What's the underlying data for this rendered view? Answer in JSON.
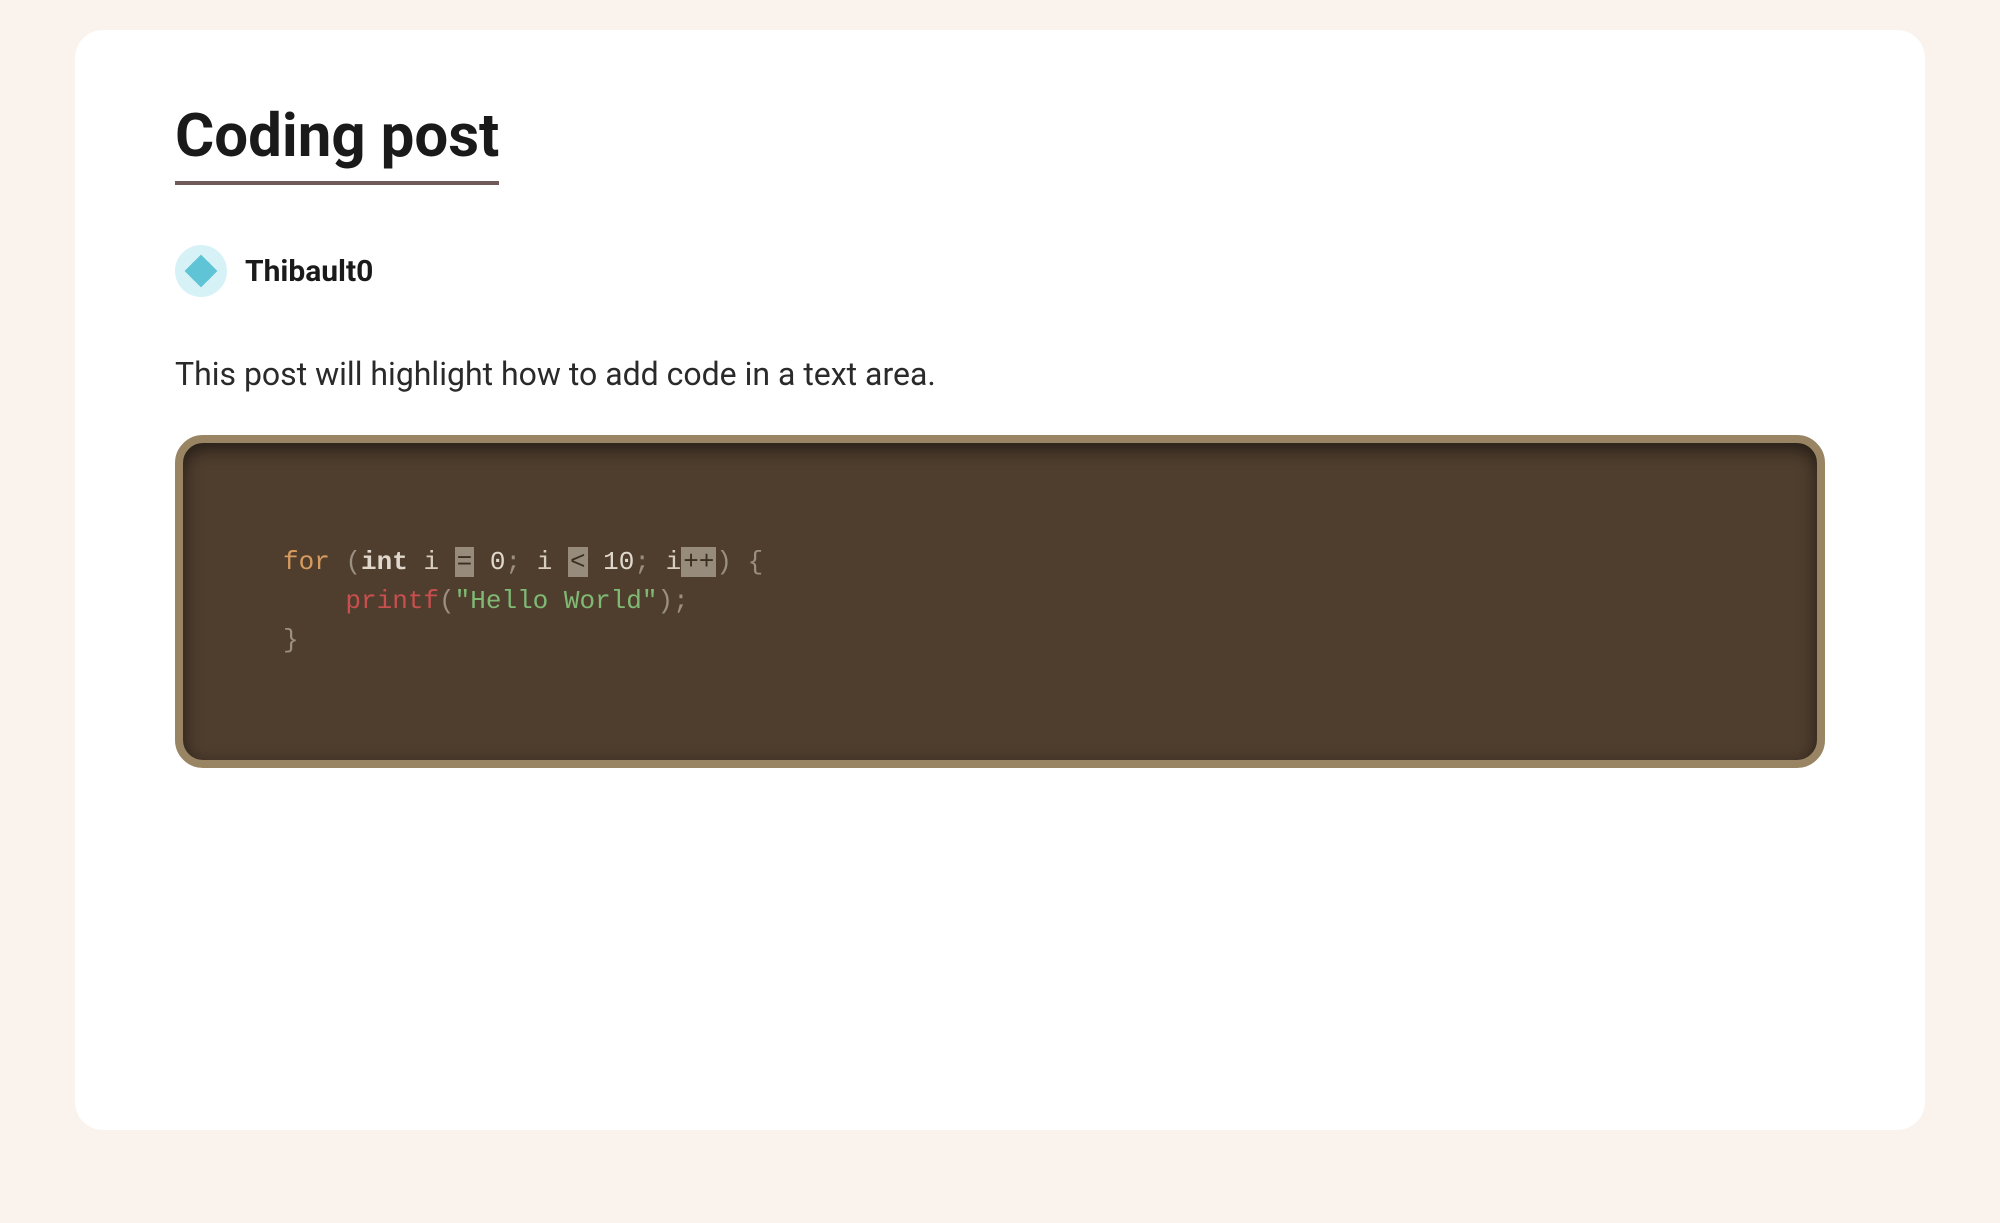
{
  "post": {
    "title": "Coding post",
    "author": "Thibault0",
    "description": "This post will highlight how to add code in a text area."
  },
  "code": {
    "tokens": {
      "for": "for",
      "open_paren": "(",
      "int": "int",
      "var_i": "i",
      "eq": "=",
      "zero": "0",
      "semi": ";",
      "lt": "<",
      "ten": "10",
      "inc": "++",
      "close_paren": ")",
      "open_brace": "{",
      "printf": "printf",
      "str_open": "(",
      "string": "\"Hello World\"",
      "str_close": ")",
      "close_brace": "}"
    },
    "indent1": "",
    "indent2": "    "
  }
}
